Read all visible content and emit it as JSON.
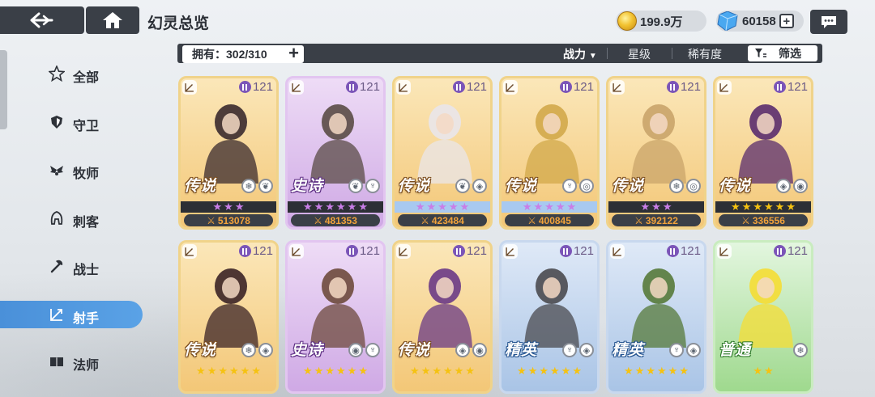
{
  "header": {
    "title": "幻灵总览",
    "gold": "199.9万",
    "gems": "60158"
  },
  "sidebar": {
    "items": [
      {
        "label": "全部",
        "icon": "star-outline-icon",
        "active": false
      },
      {
        "label": "守卫",
        "icon": "shield-icon",
        "active": false
      },
      {
        "label": "牧师",
        "icon": "wings-icon",
        "active": false
      },
      {
        "label": "刺客",
        "icon": "hood-icon",
        "active": false
      },
      {
        "label": "战士",
        "icon": "axe-icon",
        "active": false
      },
      {
        "label": "射手",
        "icon": "bow-icon",
        "active": true
      },
      {
        "label": "法师",
        "icon": "book-icon",
        "active": false
      }
    ]
  },
  "filterbar": {
    "owned": "拥有：302/310",
    "sort_power": "战力",
    "sort_star": "星级",
    "sort_rarity": "稀有度",
    "filter": "筛选"
  },
  "colors": {
    "accent": "#4a90d9",
    "dark": "#3a3f47",
    "power_text": "#f2a23a",
    "star_gold": "#f5c211",
    "star_purple": "#c97ee8"
  },
  "cards": [
    {
      "level": "121",
      "rarity": "传说",
      "stars": 3,
      "star_color": "purple",
      "band": "none",
      "power": "513078",
      "bg": "gold",
      "portrait": "#3a2a2e"
    },
    {
      "level": "121",
      "rarity": "史诗",
      "stars": 6,
      "star_color": "purple",
      "band": "none",
      "power": "481353",
      "bg": "purple",
      "portrait": "#5a4b45"
    },
    {
      "level": "121",
      "rarity": "传说",
      "stars": 5,
      "star_color": "purple",
      "band": "blue",
      "power": "423484",
      "bg": "gold",
      "portrait": "#e9e6ea"
    },
    {
      "level": "121",
      "rarity": "传说",
      "stars": 5,
      "star_color": "purple",
      "band": "blue",
      "power": "400845",
      "bg": "gold",
      "portrait": "#d2a84a"
    },
    {
      "level": "121",
      "rarity": "传说",
      "stars": 3,
      "star_color": "purple",
      "band": "none",
      "power": "392122",
      "bg": "gold",
      "portrait": "#c9a46a"
    },
    {
      "level": "121",
      "rarity": "传说",
      "stars": 6,
      "star_color": "gold",
      "band": "none",
      "power": "336556",
      "bg": "gold",
      "portrait": "#5a2c6e"
    },
    {
      "level": "121",
      "rarity": "传说",
      "stars": 6,
      "star_color": "gold",
      "band": "none",
      "power": "",
      "bg": "gold",
      "portrait": "#3b2326"
    },
    {
      "level": "121",
      "rarity": "史诗",
      "stars": 6,
      "star_color": "gold",
      "band": "none",
      "power": "",
      "bg": "purple",
      "portrait": "#6e4a3c"
    },
    {
      "level": "121",
      "rarity": "传说",
      "stars": 6,
      "star_color": "gold",
      "band": "none",
      "power": "",
      "bg": "gold",
      "portrait": "#6a3a86"
    },
    {
      "level": "121",
      "rarity": "精英",
      "stars": 6,
      "star_color": "gold",
      "band": "none",
      "power": "",
      "bg": "blue",
      "portrait": "#4a4a4f"
    },
    {
      "level": "121",
      "rarity": "精英",
      "stars": 6,
      "star_color": "gold",
      "band": "none",
      "power": "",
      "bg": "blue",
      "portrait": "#567a3a"
    },
    {
      "level": "121",
      "rarity": "普通",
      "stars": 2,
      "star_color": "gold",
      "band": "none",
      "power": "",
      "bg": "green",
      "portrait": "#f5dd34"
    }
  ]
}
